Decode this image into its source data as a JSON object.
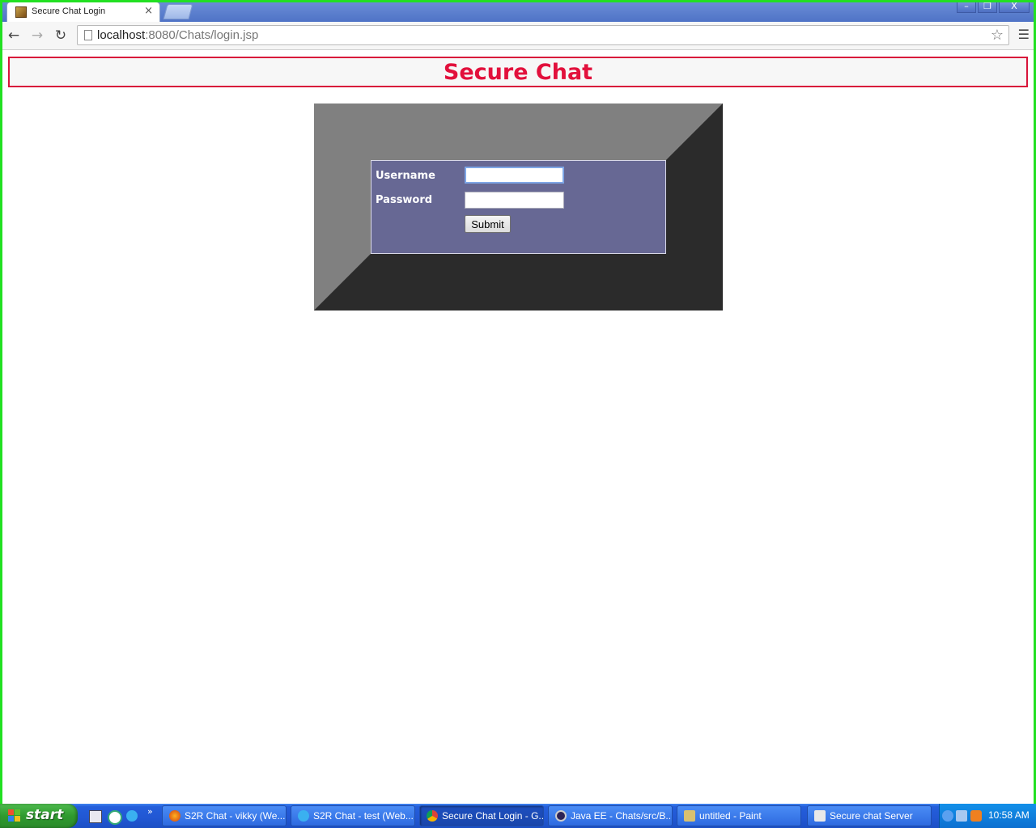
{
  "browser": {
    "tab_title": "Secure Chat Login",
    "tab_close": "×",
    "url_host": "localhost",
    "url_path": ":8080/Chats/login.jsp",
    "win_minimize": "–",
    "win_restore": "❐",
    "win_close": "X"
  },
  "nav": {
    "back": "←",
    "forward": "→",
    "reload": "↻",
    "star": "☆",
    "menu": "☰"
  },
  "page": {
    "heading": "Secure Chat",
    "username_label": "Username",
    "password_label": "Password",
    "username_value": "",
    "password_value": "",
    "submit_label": "Submit",
    "colors": {
      "heading": "#e2103c",
      "form_panel": "#676894",
      "frame_light": "#808080",
      "frame_dark": "#2b2b2b"
    }
  },
  "taskbar": {
    "start_label": "start",
    "quicklaunch_more": "»",
    "items": [
      {
        "label": "S2R Chat - vikky (We...",
        "icon": "firefox-icon"
      },
      {
        "label": "S2R Chat - test (Web...",
        "icon": "ie-icon"
      },
      {
        "label": "Secure Chat Login - G...",
        "icon": "chrome-icon"
      },
      {
        "label": "Java EE - Chats/src/B...",
        "icon": "eclipse-icon"
      },
      {
        "label": "untitled - Paint",
        "icon": "paint-icon"
      },
      {
        "label": "Secure chat Server",
        "icon": "java-icon"
      }
    ],
    "clock": "10:58 AM"
  }
}
